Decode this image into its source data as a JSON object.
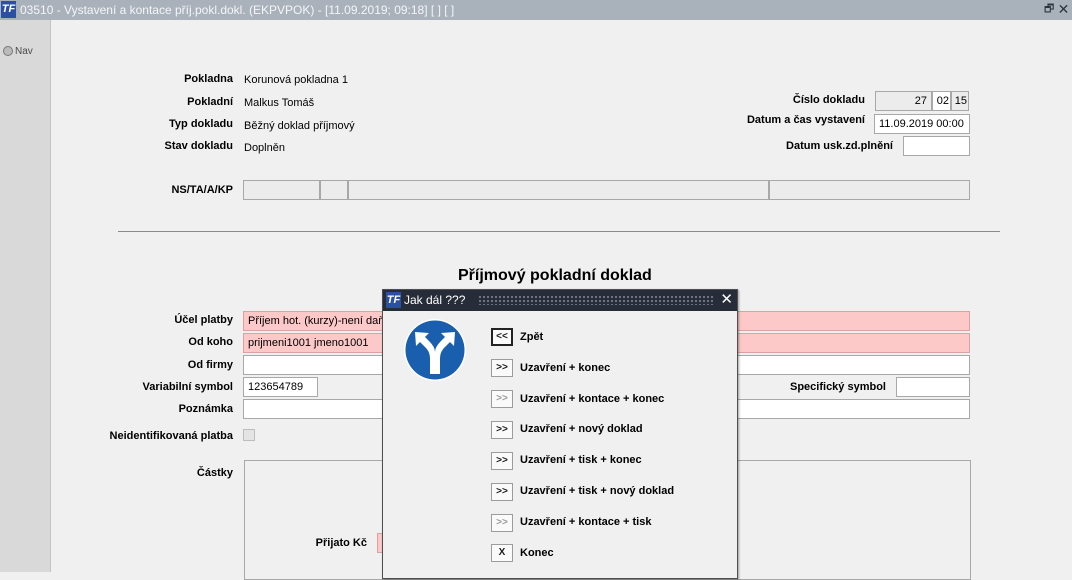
{
  "window": {
    "title": "03510 - Vystavení a kontace příj.pokl.dokl. (EKPVPOK) - [11.09.2019; 09:18]  [ ]  [ ]",
    "app_icon": "TF",
    "restore_icon": "restore-icon",
    "close_icon": "close-icon"
  },
  "left": {
    "nav_label": "Nav"
  },
  "header": {
    "pokladna_label": "Pokladna",
    "pokladna_value": "Korunová pokladna 1",
    "pokladni_label": "Pokladní",
    "pokladni_value": "Malkus Tomáš",
    "typ_label": "Typ dokladu",
    "typ_value": "Běžný doklad příjmový",
    "stav_label": "Stav dokladu",
    "stav_value": "Doplněn",
    "cislo_label": "Číslo dokladu",
    "cislo_parts": [
      "27",
      "02",
      "15"
    ],
    "datum_label": "Datum a čas vystavení",
    "datum_value": "11.09.2019 00:00",
    "usk_label": "Datum usk.zd.plnění",
    "usk_value": "",
    "ns_label": "NS/TA/A/KP"
  },
  "section": {
    "heading": "Příjmový pokladní doklad"
  },
  "form": {
    "ucel_label": "Účel platby",
    "ucel_value": "Příjem hot. (kurzy)-není daň.d",
    "odkoho_label": "Od koho",
    "odkoho_value": "prijmeni1001 jmeno1001",
    "odfirmy_label": "Od firmy",
    "vs_label": "Variabilní symbol",
    "vs_value": "123654789",
    "ss_label": "Specifický symbol",
    "ss_value": "",
    "poznamka_label": "Poznámka",
    "neid_label": "Neidentifikovaná platba",
    "castky_label": "Částky",
    "prijato_label": "Přijato Kč"
  },
  "dialog": {
    "title": "Jak dál ???",
    "icon": "turn-left-or-right-sign-icon",
    "options": [
      {
        "btn": "<<",
        "label": "Zpět",
        "enabled": true,
        "focused": true
      },
      {
        "btn": ">>",
        "label": "Uzavření + konec",
        "enabled": true
      },
      {
        "btn": ">>",
        "label": "Uzavření + kontace + konec",
        "enabled": false
      },
      {
        "btn": ">>",
        "label": "Uzavření + nový doklad",
        "enabled": true
      },
      {
        "btn": ">>",
        "label": "Uzavření + tisk + konec",
        "enabled": true
      },
      {
        "btn": ">>",
        "label": "Uzavření + tisk + nový doklad",
        "enabled": true
      },
      {
        "btn": ">>",
        "label": "Uzavření + kontace + tisk",
        "enabled": false
      },
      {
        "btn": "X",
        "label": "Konec",
        "enabled": true
      }
    ]
  },
  "colors": {
    "titlebar": "#a9b2bb",
    "dialog_titlebar": "#262d38",
    "required_field": "#fcc8c8",
    "sign_blue": "#1a5fad"
  }
}
